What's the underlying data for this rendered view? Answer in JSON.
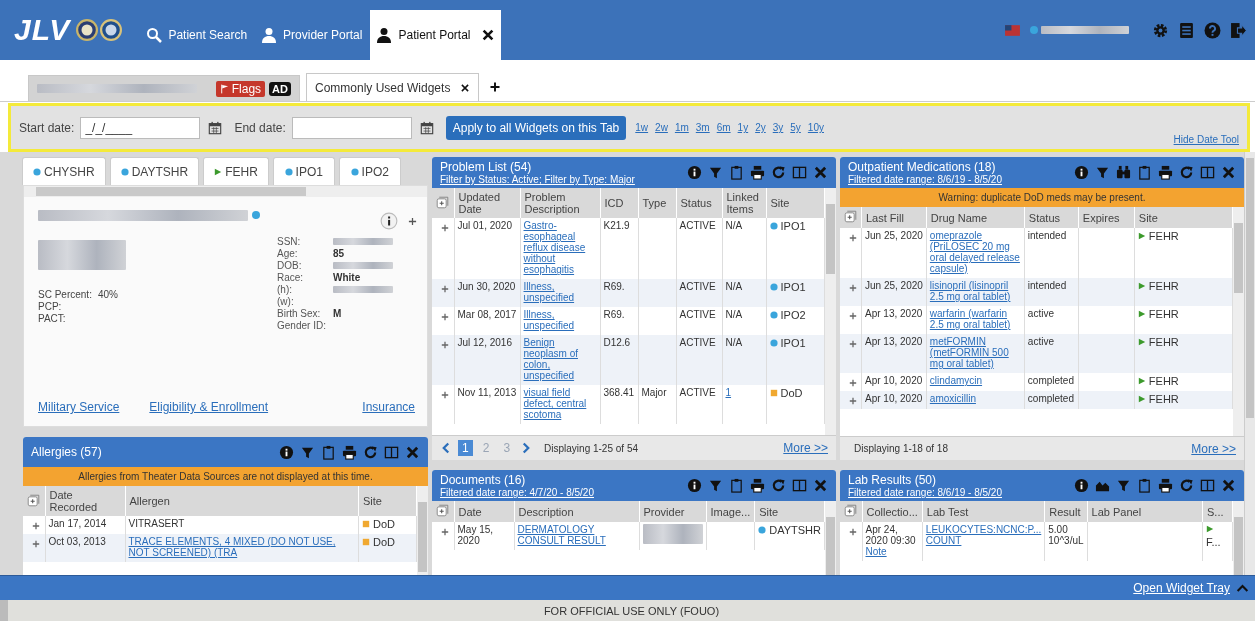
{
  "header": {
    "logo": "JLV",
    "tabs": [
      {
        "label": "Patient Search",
        "kind": "search",
        "selected": false
      },
      {
        "label": "Provider Portal",
        "kind": "provider",
        "selected": false
      },
      {
        "label": "Patient Portal",
        "kind": "patient",
        "selected": true
      }
    ]
  },
  "workspace_tabs": [
    {
      "kind": "patient",
      "flags": "Flags",
      "badge": "AD",
      "selected": false
    },
    {
      "kind": "widgets",
      "label": "Commonly Used Widgets",
      "selected": true
    }
  ],
  "date_tool": {
    "start_label": "Start date:",
    "start_value": "_/_/____",
    "end_label": "End date:",
    "apply_button": "Apply to all Widgets on this Tab",
    "ranges": [
      "1w",
      "2w",
      "1m",
      "3m",
      "6m",
      "1y",
      "2y",
      "3y",
      "5y",
      "10y"
    ],
    "hide_link": "Hide Date Tool"
  },
  "source_tabs": [
    {
      "label": "CHYSHR",
      "kind": "va"
    },
    {
      "label": "DAYTSHR",
      "kind": "va"
    },
    {
      "label": "FEHR",
      "kind": "fehr"
    },
    {
      "label": "IPO1",
      "kind": "va"
    },
    {
      "label": "IPO2",
      "kind": "va"
    }
  ],
  "patient_card": {
    "left_fields": [
      {
        "label": "SC Percent:",
        "value": "40%"
      },
      {
        "label": "PCP:"
      },
      {
        "label": "PACT:"
      }
    ],
    "right_fields": [
      {
        "label": "SSN:",
        "redacted": true
      },
      {
        "label": "Age:",
        "value": "85"
      },
      {
        "label": "DOB:",
        "redacted": true
      },
      {
        "label": "Race:",
        "value": "White"
      },
      {
        "label": "(h):",
        "redacted": true
      },
      {
        "label": "(w):"
      },
      {
        "label": "Birth Sex:",
        "value": "M"
      },
      {
        "label": "Gender ID:"
      }
    ],
    "links": [
      "Military Service",
      "Eligibility & Enrollment",
      "Insurance"
    ]
  },
  "allergies": {
    "title": "Allergies (57)",
    "tools": [
      {
        "kind": "info"
      },
      {
        "kind": "filter"
      },
      {
        "kind": "clipboard"
      },
      {
        "kind": "print"
      },
      {
        "kind": "refresh"
      },
      {
        "kind": "columns"
      },
      {
        "kind": "close"
      }
    ],
    "banner": "Allergies from Theater Data Sources are not displayed at this time.",
    "columns": [
      "Date Recorded",
      "Allergen",
      "Site"
    ],
    "rows": [
      [
        "Jan 17, 2014",
        "VITRASERT",
        {
          "site": "DoD",
          "kind": "dod"
        }
      ],
      [
        "Oct 03, 2013",
        {
          "link": "TRACE ELEMENTS, 4 MIXED (DO NOT USE, NOT SCREENED) (TRA"
        },
        {
          "site": "DoD",
          "kind": "dod"
        }
      ]
    ]
  },
  "problem_list": {
    "title": "Problem List (54)",
    "filter_link": "Filter by Status: Active; Filter by Type: Major",
    "tools": [
      {
        "kind": "info"
      },
      {
        "kind": "filter"
      },
      {
        "kind": "clipboard"
      },
      {
        "kind": "print"
      },
      {
        "kind": "refresh"
      },
      {
        "kind": "columns"
      },
      {
        "kind": "close"
      }
    ],
    "columns": [
      "Updated Date",
      "Problem Description",
      "ICD",
      "Type",
      "Status",
      "Linked Items",
      "Site"
    ],
    "rows": [
      [
        "Jul 01, 2020",
        {
          "link": "Gastro-esophageal reflux disease without esophagitis"
        },
        "K21.9",
        null,
        "ACTIVE",
        "N/A",
        {
          "site": "IPO1",
          "kind": "va"
        }
      ],
      [
        "Jun 30, 2020",
        {
          "link": "Illness, unspecified"
        },
        "R69.",
        null,
        "ACTIVE",
        "N/A",
        {
          "site": "IPO1",
          "kind": "va"
        }
      ],
      [
        "Mar 08, 2017",
        {
          "link": "Illness, unspecified"
        },
        "R69.",
        null,
        "ACTIVE",
        "N/A",
        {
          "site": "IPO2",
          "kind": "va"
        }
      ],
      [
        "Jul 12, 2016",
        {
          "link": "Benign neoplasm of colon, unspecified"
        },
        "D12.6",
        null,
        "ACTIVE",
        "N/A",
        {
          "site": "IPO1",
          "kind": "va"
        }
      ],
      [
        "Nov 11, 2013",
        {
          "link": "visual field defect, central scotoma"
        },
        "368.41",
        "Major",
        "ACTIVE",
        {
          "link": "1"
        },
        {
          "site": "DoD",
          "kind": "dod"
        }
      ]
    ],
    "pager": {
      "pages": [
        {
          "label": "1",
          "selected": true
        },
        {
          "label": "2",
          "selected": false
        },
        {
          "label": "3",
          "selected": false
        }
      ],
      "status": "Displaying 1-25 of 54",
      "more": "More >>"
    }
  },
  "documents": {
    "title": "Documents (16)",
    "filter_link": "Filtered date range: 4/7/20 - 8/5/20",
    "tools": [
      {
        "kind": "info"
      },
      {
        "kind": "filter"
      },
      {
        "kind": "clipboard"
      },
      {
        "kind": "print"
      },
      {
        "kind": "refresh"
      },
      {
        "kind": "columns"
      },
      {
        "kind": "close"
      }
    ],
    "columns": [
      "Date",
      "Description",
      "Provider",
      "Image...",
      "Site"
    ],
    "rows": [
      [
        "May 15, 2020",
        {
          "link": "DERMATOLOGY CONSULT RESULT"
        },
        {
          "redacted": true
        },
        null,
        {
          "site": "DAYTSHR",
          "kind": "va"
        }
      ]
    ]
  },
  "outpatient_medications": {
    "title": "Outpatient Medications (18)",
    "filter_link": "Filtered date range: 8/6/19 - 8/5/20",
    "tools": [
      {
        "kind": "info"
      },
      {
        "kind": "filter"
      },
      {
        "kind": "binoculars"
      },
      {
        "kind": "clipboard"
      },
      {
        "kind": "print"
      },
      {
        "kind": "refresh"
      },
      {
        "kind": "columns"
      },
      {
        "kind": "close"
      }
    ],
    "banner": "Warning: duplicate DoD meds may be present.",
    "columns": [
      "Last Fill",
      "Drug Name",
      "Status",
      "Expires",
      "Site"
    ],
    "rows": [
      [
        "Jun 25, 2020",
        {
          "link": "omeprazole (PriLOSEC 20 mg oral delayed release capsule)"
        },
        "intended",
        null,
        {
          "site": "FEHR",
          "kind": "fehr"
        }
      ],
      [
        "Jun 25, 2020",
        {
          "link": "lisinopril (lisinopril 2.5 mg oral tablet)"
        },
        "intended",
        null,
        {
          "site": "FEHR",
          "kind": "fehr"
        }
      ],
      [
        "Apr 13, 2020",
        {
          "link": "warfarin (warfarin 2.5 mg oral tablet)"
        },
        "active",
        null,
        {
          "site": "FEHR",
          "kind": "fehr"
        }
      ],
      [
        "Apr 13, 2020",
        {
          "link": "metFORMIN (metFORMIN 500 mg oral tablet)"
        },
        "active",
        null,
        {
          "site": "FEHR",
          "kind": "fehr"
        }
      ],
      [
        "Apr 10, 2020",
        {
          "link": "clindamycin"
        },
        "completed",
        null,
        {
          "site": "FEHR",
          "kind": "fehr"
        }
      ],
      [
        "Apr 10, 2020",
        {
          "link": "amoxicillin"
        },
        "completed",
        null,
        {
          "site": "FEHR",
          "kind": "fehr"
        }
      ]
    ],
    "pager": {
      "status": "Displaying 1-18 of 18",
      "more": "More >>"
    }
  },
  "lab_results": {
    "title": "Lab Results (50)",
    "filter_link": "Filtered date range: 8/6/19 - 8/5/20",
    "tools": [
      {
        "kind": "info"
      },
      {
        "kind": "chart"
      },
      {
        "kind": "filter"
      },
      {
        "kind": "clipboard"
      },
      {
        "kind": "print"
      },
      {
        "kind": "refresh"
      },
      {
        "kind": "columns"
      },
      {
        "kind": "close"
      }
    ],
    "columns": [
      "Collectio...",
      "Lab Test",
      "Result",
      "Lab Panel",
      "S..."
    ],
    "rows": [
      [
        {
          "text": "Apr 24, 2020 09:30",
          "note": "Note"
        },
        {
          "link": "LEUKOCYTES:NCNC:P... COUNT"
        },
        "5.00 10^3/uL",
        null,
        {
          "site": "F...",
          "kind": "fehr"
        }
      ]
    ]
  },
  "widget_tray": {
    "link": "Open Widget Tray"
  },
  "footer": {
    "text": "FOR OFFICIAL USE ONLY (FOUO)"
  }
}
